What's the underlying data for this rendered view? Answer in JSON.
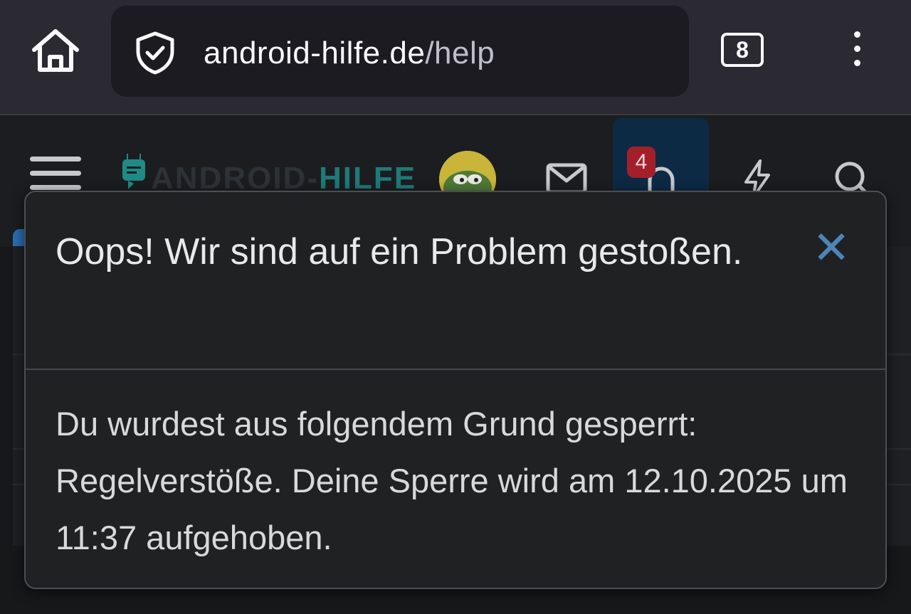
{
  "browser": {
    "url_domain": "android-hilfe.de",
    "url_path": "/help",
    "tab_count": "8",
    "icons": [
      "home-icon",
      "shield-check-icon",
      "tabs-counter",
      "kebab-menu-icon"
    ]
  },
  "site_header": {
    "logo_prefix": "ANDROID-",
    "logo_accent": "HILFE",
    "notification_count": "4",
    "icons": [
      "hamburger-icon",
      "android-robot-icon",
      "avatar",
      "mail-icon",
      "bell-icon",
      "bolt-icon",
      "search-icon"
    ]
  },
  "error_dialog": {
    "title": "Oops! Wir sind auf ein Problem gestoßen.",
    "close_icon": "close-icon",
    "message": "Du wurdest aus folgendem Grund gesperrt: Regelverstöße. Deine Sperre wird am 12.10.2025 um 11:37 aufgehoben."
  },
  "colors": {
    "browser_bar": "#2b2a33",
    "url_box": "#1c1b22",
    "page_bg": "#17181a",
    "dialog_bg": "#1f2123",
    "close_accent": "#4c86b9",
    "badge": "#a3202a",
    "notif_active": "#0d2a45",
    "logo_accent": "#1f7a78"
  }
}
